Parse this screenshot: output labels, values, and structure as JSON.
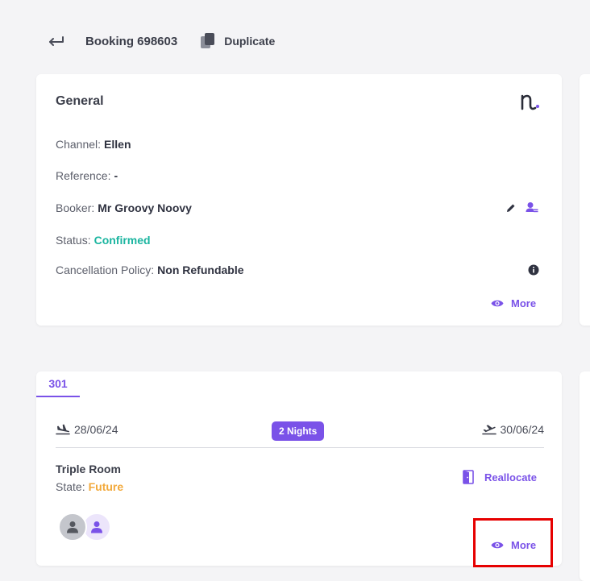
{
  "header": {
    "booking_title": "Booking 698603",
    "duplicate_label": "Duplicate"
  },
  "general": {
    "title": "General",
    "channel_label": "Channel:",
    "channel_value": "Ellen",
    "reference_label": "Reference:",
    "reference_value": "-",
    "booker_label": "Booker:",
    "booker_value": "Mr Groovy Noovy",
    "status_label": "Status:",
    "status_value": "Confirmed",
    "cancellation_label": "Cancellation Policy:",
    "cancellation_value": "Non Refundable",
    "more_label": "More"
  },
  "room": {
    "tab_label": "301",
    "checkin_date": "28/06/24",
    "checkout_date": "30/06/24",
    "nights_badge": "2 Nights",
    "room_type": "Triple Room",
    "state_label": "State:",
    "state_value": "Future",
    "reallocate_label": "Reallocate",
    "more_label": "More"
  },
  "colors": {
    "accent": "#7a52e8",
    "confirmed": "#1bb5a0",
    "future": "#f2a93b",
    "highlight": "#e60000"
  },
  "icons": {
    "back": "arrow-left-return-icon",
    "duplicate": "copy-icon",
    "brand": "brand-logo-icon",
    "edit": "pencil-icon",
    "change_user": "user-swap-icon",
    "info": "info-icon",
    "more": "eye-icon",
    "checkin": "plane-landing-icon",
    "checkout": "plane-takeoff-icon",
    "reallocate": "door-icon",
    "guest": "person-icon"
  }
}
